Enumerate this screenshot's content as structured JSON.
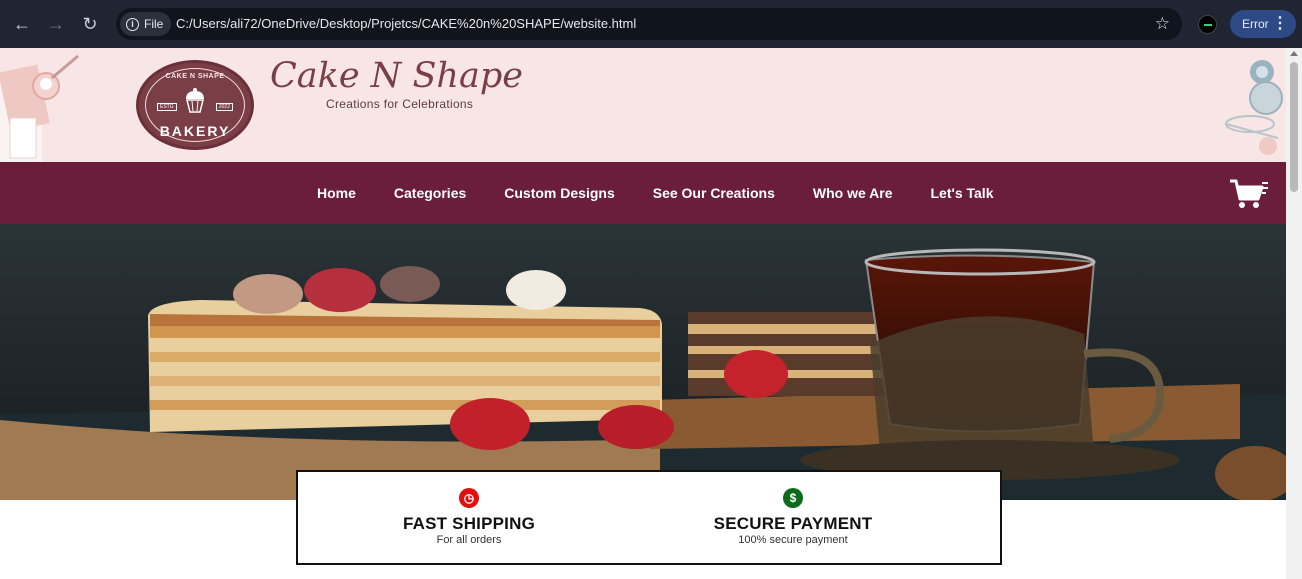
{
  "browser": {
    "file_label": "File",
    "url": "C:/Users/ali72/OneDrive/Desktop/Projetcs/CAKE%20n%20SHAPE/website.html",
    "error_label": "Error"
  },
  "header": {
    "logo": {
      "top_text": "CAKE N SHAPE",
      "estg": "ESTG",
      "year": "2022",
      "bottom_text": "BAKERY"
    },
    "brand": "Cake N Shape",
    "tagline": "Creations for Celebrations"
  },
  "nav": {
    "items": [
      "Home",
      "Categories",
      "Custom Designs",
      "See Our Creations",
      "Who we Are",
      "Let's Talk"
    ]
  },
  "features": [
    {
      "title": "FAST SHIPPING",
      "subtitle": "For all orders",
      "icon": "clock-icon",
      "color": "#e10f0f"
    },
    {
      "title": "SECURE PAYMENT",
      "subtitle": "100% secure payment",
      "icon": "dollar-icon",
      "color": "#0c6b1a"
    }
  ],
  "colors": {
    "nav": "#6b1e3a",
    "header_bg": "#f8e6e6",
    "brand": "#7a3e47"
  }
}
